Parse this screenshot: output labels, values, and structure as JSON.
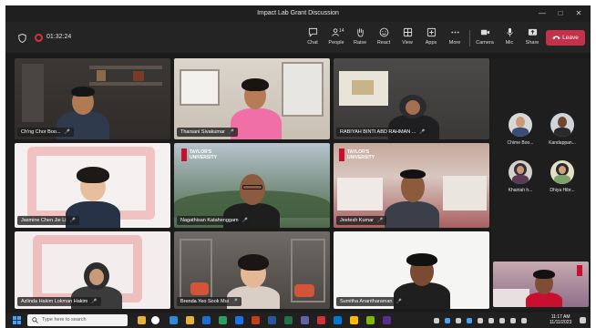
{
  "window": {
    "title": "Impact Lab Grant Discussion"
  },
  "meeting": {
    "timer": "01:32:24"
  },
  "toolbar": {
    "chat": "Chat",
    "people": "People",
    "people_count": "14",
    "raise": "Raise",
    "react": "React",
    "view": "View",
    "apps": "Apps",
    "more": "More",
    "camera": "Camera",
    "mic": "Mic",
    "share": "Share",
    "leave": "Leave"
  },
  "tiles": [
    {
      "name": "Ch'ng Chor Boo..."
    },
    {
      "name": "Tharsani Sivakumar"
    },
    {
      "name": "RABIYAH BINTI ABD RAHMAN ..."
    },
    {
      "name": "Jasmine Chen Jie Li"
    },
    {
      "name": "Nagathisan Katahenggam"
    },
    {
      "name": "Jeetesh Kumar"
    },
    {
      "name": "Azlinda Hakim Lokman Hakim"
    },
    {
      "name": "Brenda Yeo Sook Mui"
    },
    {
      "name": "Sumitha Anantharaman"
    }
  ],
  "tile_texts": {
    "campus_logo": "TAYLOR'S UNIVERSITY"
  },
  "side_panel": [
    {
      "name": "Chime Boo..."
    },
    {
      "name": "Kandappan..."
    },
    {
      "name": "Khairiah h..."
    },
    {
      "name": "Dhiya Hibr..."
    }
  ],
  "taskbar": {
    "search_placeholder": "Type here to search",
    "time": "11:17 AM",
    "date": "11/11/2023"
  },
  "colors": {
    "leave": "#c4314b",
    "recording": "#d13438",
    "pink_shirt": "#f06fa6"
  },
  "icons": [
    "shield-icon",
    "chat-icon",
    "people-icon",
    "raise-hand-icon",
    "react-icon",
    "view-icon",
    "apps-icon",
    "more-icon",
    "camera-icon",
    "mic-icon",
    "share-icon",
    "phone-icon",
    "windows-icon",
    "search-icon"
  ]
}
